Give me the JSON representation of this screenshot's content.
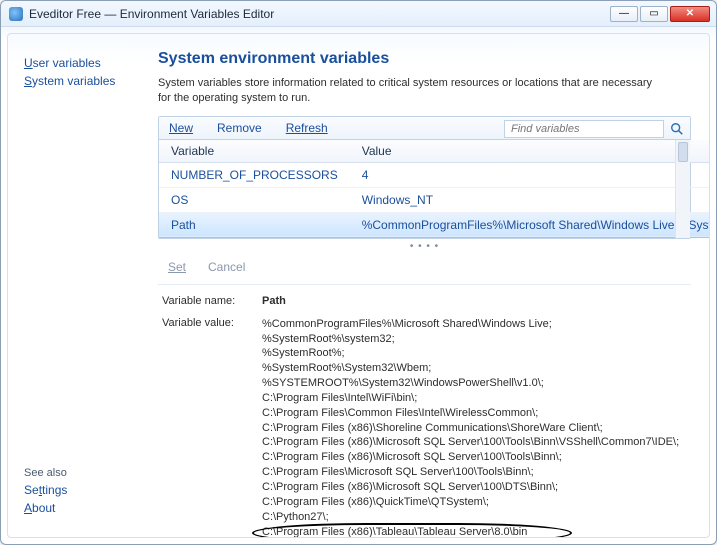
{
  "window": {
    "title": "Eveditor Free — Environment Variables Editor"
  },
  "sidebar": {
    "top": [
      {
        "label": "User variables",
        "accel": "U"
      },
      {
        "label": "System variables",
        "accel": "S"
      }
    ],
    "see_also_label": "See also",
    "bottom": [
      {
        "label": "Settings",
        "accel": "t"
      },
      {
        "label": "About",
        "accel": "A"
      }
    ]
  },
  "main": {
    "heading": "System environment variables",
    "description": "System variables store information related to critical system resources or locations that are necessary for the operating system to run."
  },
  "toolbar": {
    "new": "New",
    "remove": "Remove",
    "refresh": "Refresh",
    "search_placeholder": "Find variables"
  },
  "grid": {
    "col_variable": "Variable",
    "col_value": "Value",
    "rows": [
      {
        "var": "NUMBER_OF_PROCESSORS",
        "val": "4",
        "selected": false
      },
      {
        "var": "OS",
        "val": "Windows_NT",
        "selected": false
      },
      {
        "var": "Path",
        "val": "%CommonProgramFiles%\\Microsoft Shared\\Windows Live;%System",
        "selected": true
      }
    ]
  },
  "edit": {
    "set": "Set",
    "cancel": "Cancel"
  },
  "detail": {
    "name_label": "Variable name:",
    "name_value": "Path",
    "value_label": "Variable value:",
    "value_lines": [
      "%CommonProgramFiles%\\Microsoft Shared\\Windows Live;",
      "%SystemRoot%\\system32;",
      "%SystemRoot%;",
      "%SystemRoot%\\System32\\Wbem;",
      "%SYSTEMROOT%\\System32\\WindowsPowerShell\\v1.0\\;",
      "C:\\Program Files\\Intel\\WiFi\\bin\\;",
      "C:\\Program Files\\Common Files\\Intel\\WirelessCommon\\;",
      "C:\\Program Files (x86)\\Shoreline Communications\\ShoreWare Client\\;",
      "C:\\Program Files (x86)\\Microsoft SQL Server\\100\\Tools\\Binn\\VSShell\\Common7\\IDE\\;",
      "C:\\Program Files (x86)\\Microsoft SQL Server\\100\\Tools\\Binn\\;",
      "C:\\Program Files\\Microsoft SQL Server\\100\\Tools\\Binn\\;",
      "C:\\Program Files (x86)\\Microsoft SQL Server\\100\\DTS\\Binn\\;",
      "C:\\Program Files (x86)\\QuickTime\\QTSystem\\;",
      "C:\\Python27\\;",
      "C:\\Program Files (x86)\\Tableau\\Tableau Server\\8.0\\bin"
    ]
  }
}
